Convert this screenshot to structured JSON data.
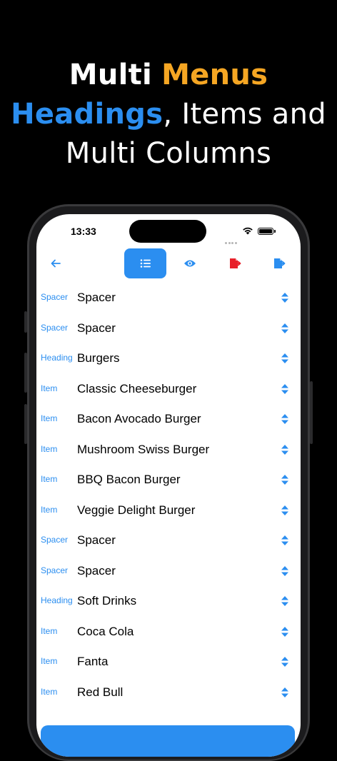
{
  "headline": {
    "line1_a": "Multi",
    "line1_b": "Menus",
    "line2_a": "Headings",
    "line2_b": ", Items and",
    "line3": "Multi Columns"
  },
  "status_bar": {
    "time": "13:33"
  },
  "colors": {
    "accent": "#2b8ef0",
    "orange": "#f5a623",
    "red": "#e8202a"
  },
  "toolbar": {
    "back_icon": "arrow-left-icon",
    "list_icon": "list-icon",
    "preview_icon": "eye-icon",
    "pdf_icon": "pdf-export-icon",
    "export_icon": "document-export-icon"
  },
  "rows": [
    {
      "type": "Spacer",
      "name": "Spacer"
    },
    {
      "type": "Spacer",
      "name": "Spacer"
    },
    {
      "type": "Heading",
      "name": "Burgers"
    },
    {
      "type": "Item",
      "name": "Classic Cheeseburger"
    },
    {
      "type": "Item",
      "name": "Bacon Avocado Burger"
    },
    {
      "type": "Item",
      "name": "Mushroom Swiss Burger"
    },
    {
      "type": "Item",
      "name": "BBQ Bacon Burger"
    },
    {
      "type": "Item",
      "name": "Veggie Delight Burger"
    },
    {
      "type": "Spacer",
      "name": "Spacer"
    },
    {
      "type": "Spacer",
      "name": "Spacer"
    },
    {
      "type": "Heading",
      "name": "Soft Drinks"
    },
    {
      "type": "Item",
      "name": "Coca Cola"
    },
    {
      "type": "Item",
      "name": "Fanta"
    },
    {
      "type": "Item",
      "name": "Red Bull"
    }
  ]
}
